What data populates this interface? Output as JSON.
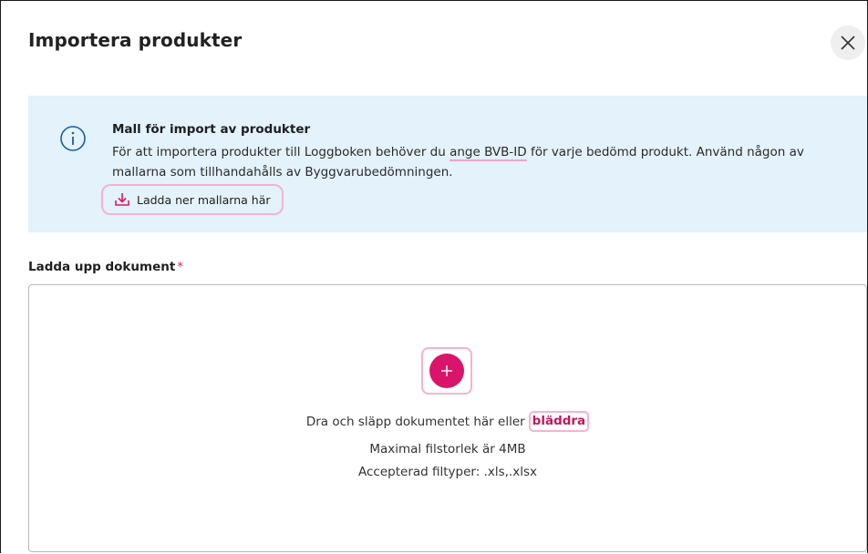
{
  "dialog": {
    "title": "Importera produkter"
  },
  "info": {
    "title": "Mall för import av produkter",
    "text_part1": "För att importera produkter till Loggboken behöver du ",
    "text_highlight": "ange BVB-ID",
    "text_part2": " för varje bedömd produkt. Använd någon av mallarna som tillhandahålls av Byggvarubedömningen.",
    "download_label": "Ladda ner mallarna här"
  },
  "upload": {
    "label": "Ladda upp dokument",
    "required_marker": "*",
    "drop_text": "Dra och släpp dokumentet här eller",
    "browse_label": "bläddra",
    "max_size": "Maximal filstorlek är 4MB",
    "accepted_types": "Accepterad filtyper: .xls,.xlsx"
  },
  "colors": {
    "accent": "#d9146a",
    "info_bg": "#e3f2fb",
    "highlight_outline": "#f5b3d0"
  },
  "icons": {
    "close": "close-icon",
    "info": "info-icon",
    "download": "download-icon",
    "add": "plus-icon"
  }
}
